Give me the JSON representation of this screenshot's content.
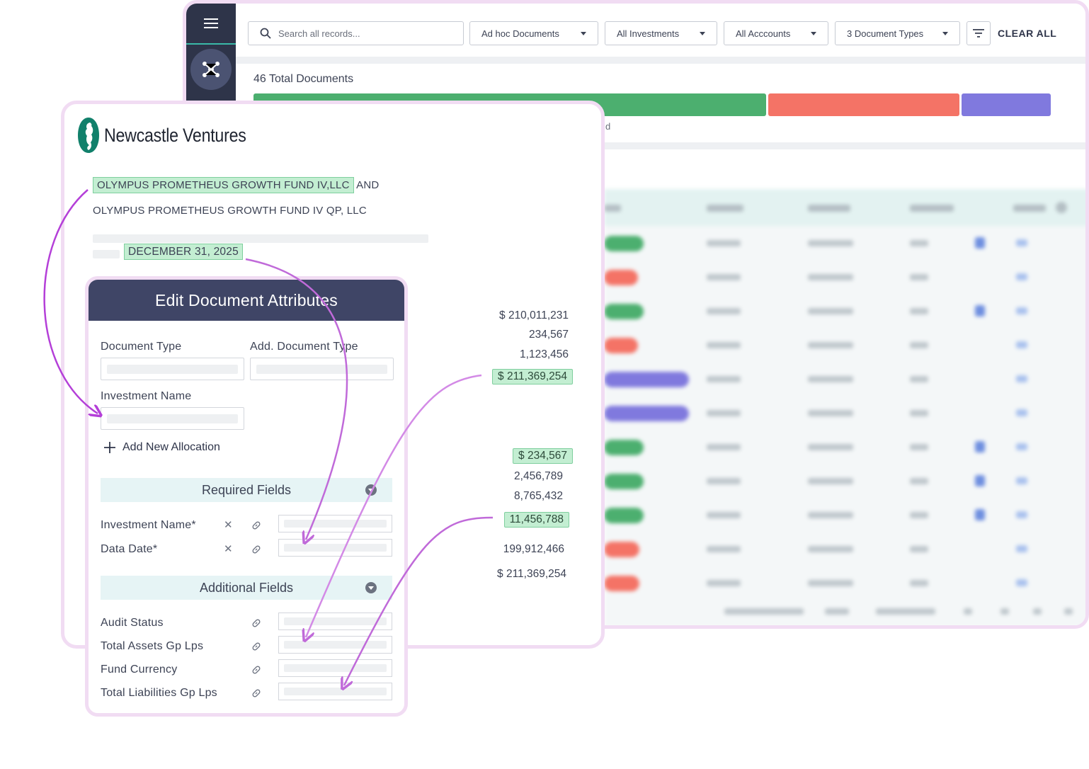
{
  "app": {
    "search_placeholder": "Search all records...",
    "filters": [
      {
        "label": "Ad hoc Documents"
      },
      {
        "label": "All Investments"
      },
      {
        "label": "All Acccounts"
      },
      {
        "label": "3 Document Types"
      }
    ],
    "clear_all": "CLEAR ALL",
    "total_documents": "46 Total Documents",
    "distribution": [
      {
        "share": 0.63,
        "color": "#4caf6f"
      },
      {
        "share": 0.235,
        "color": "#f47366"
      },
      {
        "share": 0.11,
        "color": "#8079de"
      }
    ],
    "partial_text": "d"
  },
  "doc": {
    "brand": "Newcastle Ventures",
    "fund_1": "OLYMPUS PROMETHEUS GROWTH FUND IV,LLC",
    "and_word": "AND",
    "fund_2": "OLYMPUS PROMETHEUS GROWTH FUND IV QP, LLC",
    "date": "DECEMBER 31, 2025",
    "numbers": {
      "n1": "$ 210,011,231",
      "n2": "234,567",
      "n3": "1,123,456",
      "n4": "$ 211,369,254",
      "n5": "$ 234,567",
      "n6": "2,456,789",
      "n7": "8,765,432",
      "n8": "11,456,788",
      "n9": "199,912,466",
      "n10": "$ 211,369,254"
    }
  },
  "edit": {
    "title": "Edit Document Attributes",
    "document_type": "Document Type",
    "add_document_type": "Add. Document Type",
    "investment_name": "Investment Name",
    "add_allocation": "Add New Allocation",
    "required_title": "Required Fields",
    "required": [
      {
        "label": "Investment Name*"
      },
      {
        "label": "Data Date*"
      }
    ],
    "additional_title": "Additional Fields",
    "additional": [
      {
        "label": "Audit Status"
      },
      {
        "label": "Total Assets Gp Lps"
      },
      {
        "label": "Fund Currency"
      },
      {
        "label": "Total Liabilities Gp Lps"
      }
    ]
  }
}
